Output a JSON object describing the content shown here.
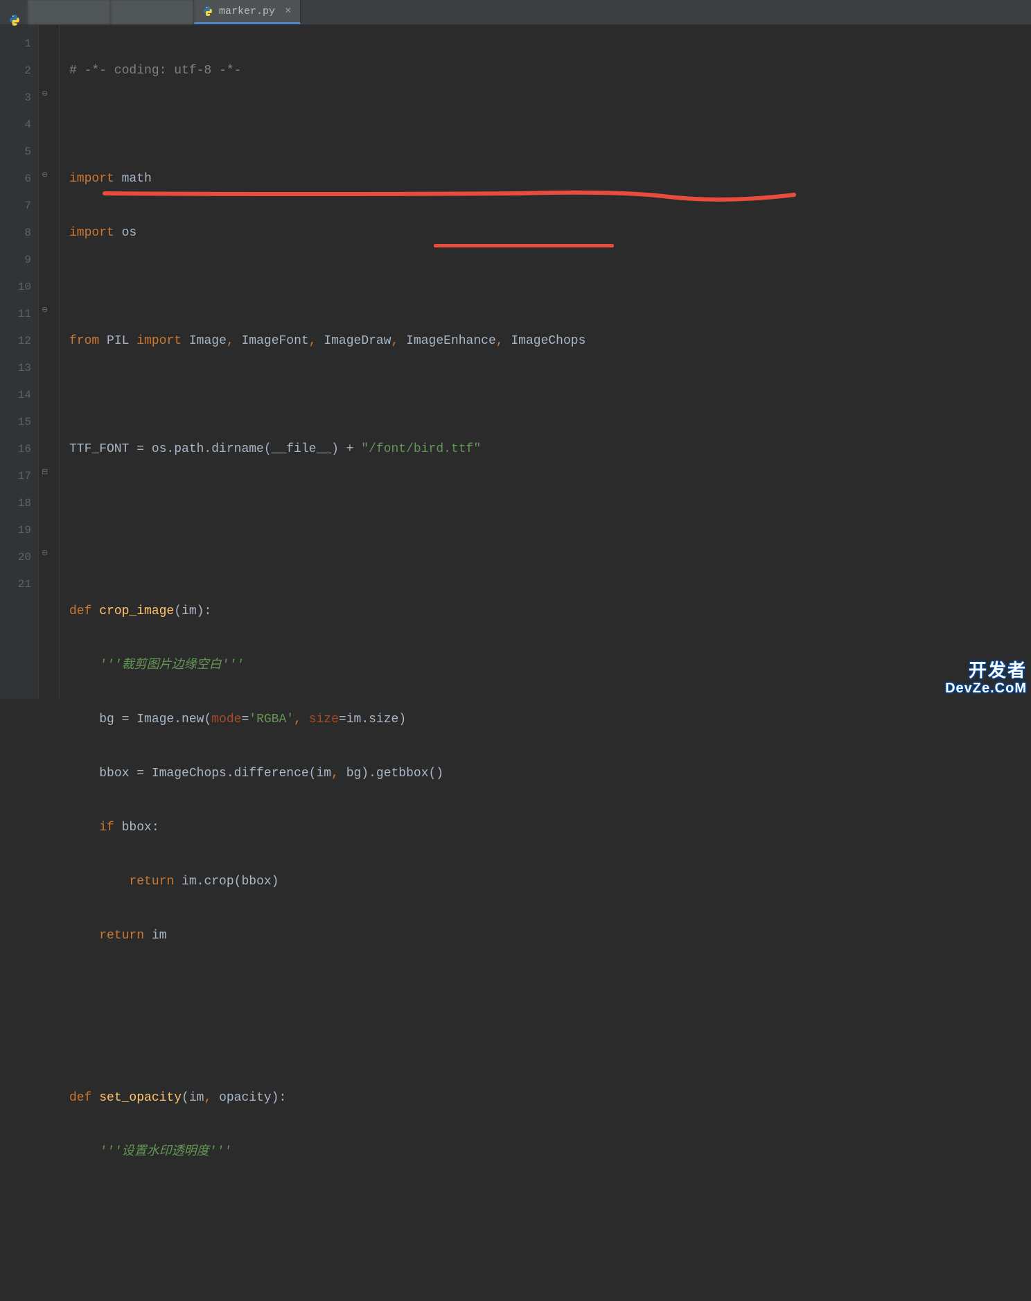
{
  "tabs": {
    "inactive1": "",
    "inactive2": "",
    "active": {
      "label": "marker.py",
      "close": "×"
    }
  },
  "gutter": [
    "1",
    "2",
    "3",
    "4",
    "5",
    "6",
    "7",
    "8",
    "9",
    "10",
    "11",
    "12",
    "13",
    "14",
    "15",
    "16",
    "17",
    "18",
    "19",
    "20",
    "21"
  ],
  "code": {
    "l1_comment": "# -*- coding: utf-8 -*-",
    "l3": {
      "kw": "import ",
      "mod": "math"
    },
    "l4": {
      "kw": "import ",
      "mod": "os"
    },
    "l6": {
      "kw1": "from ",
      "mod": "PIL ",
      "kw2": "import ",
      "names": "Image",
      "c1": ", ",
      "n2": "ImageFont",
      "c2": ", ",
      "n3": "ImageDraw",
      "c3": ", ",
      "n4": "ImageEnhance",
      "c4": ", ",
      "n5": "ImageChops"
    },
    "l8": {
      "lhs": "TTF_FONT = os.path.dirname(",
      "file": "__file__",
      "mid": ") + ",
      "str": "\"/font/bird.ttf\""
    },
    "l11": {
      "kw": "def ",
      "fn": "crop_image",
      "sig": "(im):"
    },
    "l12_doc": "'''裁剪图片边缘空白'''",
    "l13": {
      "pre": "bg = Image.new(",
      "kw1": "mode",
      "eq1": "=",
      "s1": "'RGBA'",
      "c": ", ",
      "kw2": "size",
      "eq2": "=im.size)"
    },
    "l14": "bbox = ImageChops.difference(im",
    "l14b": ", ",
    "l14c": "bg).getbbox()",
    "l15": {
      "kw": "if ",
      "rest": "bbox:"
    },
    "l16": {
      "kw": "return ",
      "rest": "im.crop(bbox)"
    },
    "l17": {
      "kw": "return ",
      "rest": "im"
    },
    "l20": {
      "kw": "def ",
      "fn": "set_opacity",
      "sig": "(im",
      "c": ", ",
      "p2": "opacity):"
    },
    "l21_doc": "'''设置水印透明度'''"
  },
  "watermark": {
    "line1": "开发者",
    "line2": "DevZe.CoM"
  }
}
